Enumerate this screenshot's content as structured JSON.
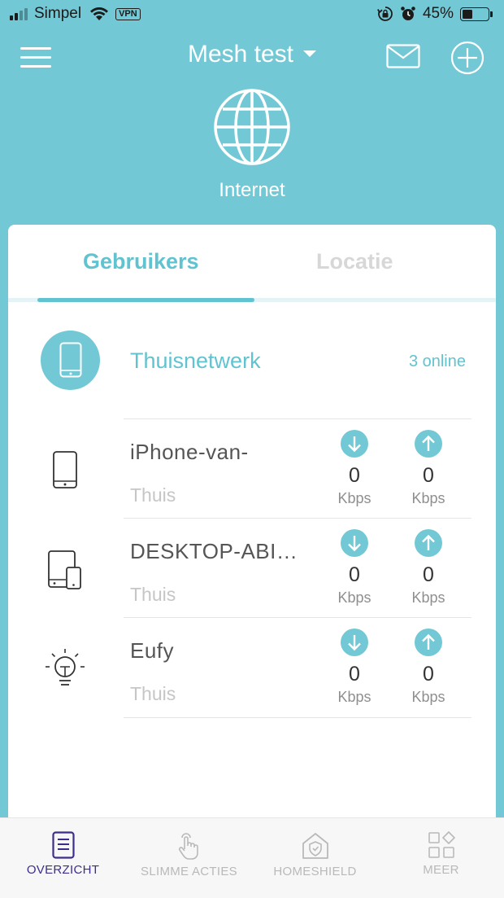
{
  "status_bar": {
    "carrier": "Simpel",
    "vpn": "VPN",
    "battery": "45%"
  },
  "header": {
    "title": "Mesh test"
  },
  "internet": {
    "label": "Internet"
  },
  "tabs": [
    {
      "label": "Gebruikers",
      "active": true
    },
    {
      "label": "Locatie",
      "active": false
    }
  ],
  "group": {
    "name": "Thuisnetwerk",
    "online": "3 online"
  },
  "devices": [
    {
      "name": "iPhone-van-",
      "location": "Thuis",
      "icon": "phone-icon",
      "down": "0",
      "down_unit": "Kbps",
      "up": "0",
      "up_unit": "Kbps"
    },
    {
      "name": "DESKTOP-ABI…",
      "location": "Thuis",
      "icon": "desktop-tablet-icon",
      "down": "0",
      "down_unit": "Kbps",
      "up": "0",
      "up_unit": "Kbps"
    },
    {
      "name": "Eufy",
      "location": "Thuis",
      "icon": "lightbulb-icon",
      "down": "0",
      "down_unit": "Kbps",
      "up": "0",
      "up_unit": "Kbps"
    }
  ],
  "bottom_nav": [
    {
      "label": "OVERZICHT",
      "icon": "overview-icon",
      "active": true
    },
    {
      "label": "SLIMME ACTIES",
      "icon": "hand-tap-icon",
      "active": false
    },
    {
      "label": "HOMESHIELD",
      "icon": "home-shield-icon",
      "active": false
    },
    {
      "label": "MEER",
      "icon": "more-grid-icon",
      "active": false
    }
  ],
  "colors": {
    "brand": "#72c8d4",
    "accent": "#62c3d0",
    "nav_active": "#3d2e8a"
  }
}
